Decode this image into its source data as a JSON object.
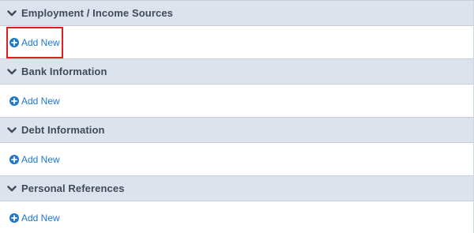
{
  "sections": [
    {
      "title": "Employment / Income Sources",
      "action_label": "Add New"
    },
    {
      "title": "Bank Information",
      "action_label": "Add New"
    },
    {
      "title": "Debt Information",
      "action_label": "Add New"
    },
    {
      "title": "Personal References",
      "action_label": "Add New"
    }
  ],
  "icons": {
    "collapse": "chevron-down-icon",
    "add": "plus-circle-icon"
  },
  "colors": {
    "header_bg": "#dde3ec",
    "header_text": "#3f4a5a",
    "link": "#1f77c9",
    "highlight": "#e02020"
  }
}
